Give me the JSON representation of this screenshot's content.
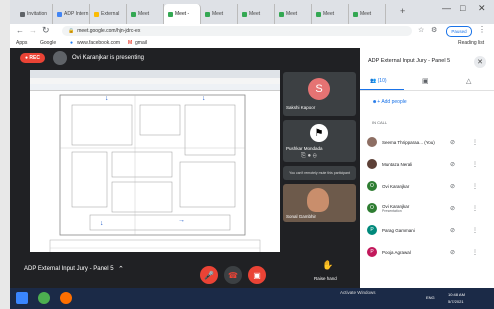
{
  "browser": {
    "tabs": [
      {
        "label": "Invitation"
      },
      {
        "label": "ADP Intern"
      },
      {
        "label": "External"
      },
      {
        "label": "Meet"
      },
      {
        "label": "Meet - ",
        "active": true
      },
      {
        "label": "Meet"
      },
      {
        "label": "Meet"
      },
      {
        "label": "Meet"
      },
      {
        "label": "Meet"
      },
      {
        "label": "Meet"
      }
    ],
    "new_tab": "+",
    "url": "meet.google.com/hjn-jdrc-ex",
    "paused_label": "Paused",
    "bookmarks": [
      {
        "label": "Apps"
      },
      {
        "label": "Google"
      },
      {
        "label": "www.facebook.com"
      },
      {
        "label": "gmail"
      }
    ],
    "reading_list": "Reading list"
  },
  "meet": {
    "rec_label": "REC",
    "presenting_text": "Ovi Karanjkar is presenting",
    "tiles": [
      {
        "name": "Sakshi Kapoor",
        "initial": "S",
        "color": "#e57373"
      },
      {
        "name": "Pushkar Mondada"
      },
      {
        "tooltip": "You can't remotely mute this participant"
      },
      {
        "name": "Sonal Gambhir"
      }
    ],
    "meeting_name": "ADP External Input Jury - Panel 5",
    "raise_hand": "Raise hand",
    "captions": "Turn on captions",
    "presenting_footer": "Ovi Karanjkar is presenting",
    "activate": "Activate Windows",
    "activate_sub": "Go to Settings to activate Windows."
  },
  "panel": {
    "title": "ADP External Input Jury - Panel 5",
    "people_count": "(10)",
    "add_people": "Add people",
    "in_call": "IN CALL",
    "people": [
      {
        "name": "Seema Thripparaa... (You)",
        "color": "#8d6e63"
      },
      {
        "name": "Muntaza Nerali",
        "color": "#5d4037"
      },
      {
        "name": "Ovi Karanjkar",
        "color": "#2e7d32",
        "initial": "O"
      },
      {
        "name": "Ovi Karanjkar",
        "sub": "Presentation",
        "color": "#2e7d32",
        "initial": "O"
      },
      {
        "name": "Parag Gammani",
        "color": "#00897b",
        "initial": "P"
      },
      {
        "name": "Pooja Agrawal",
        "color": "#c2185b",
        "initial": "P"
      }
    ]
  },
  "taskbar": {
    "time": "10:48 AM",
    "date": "5/7/2021",
    "lang": "ENG"
  }
}
